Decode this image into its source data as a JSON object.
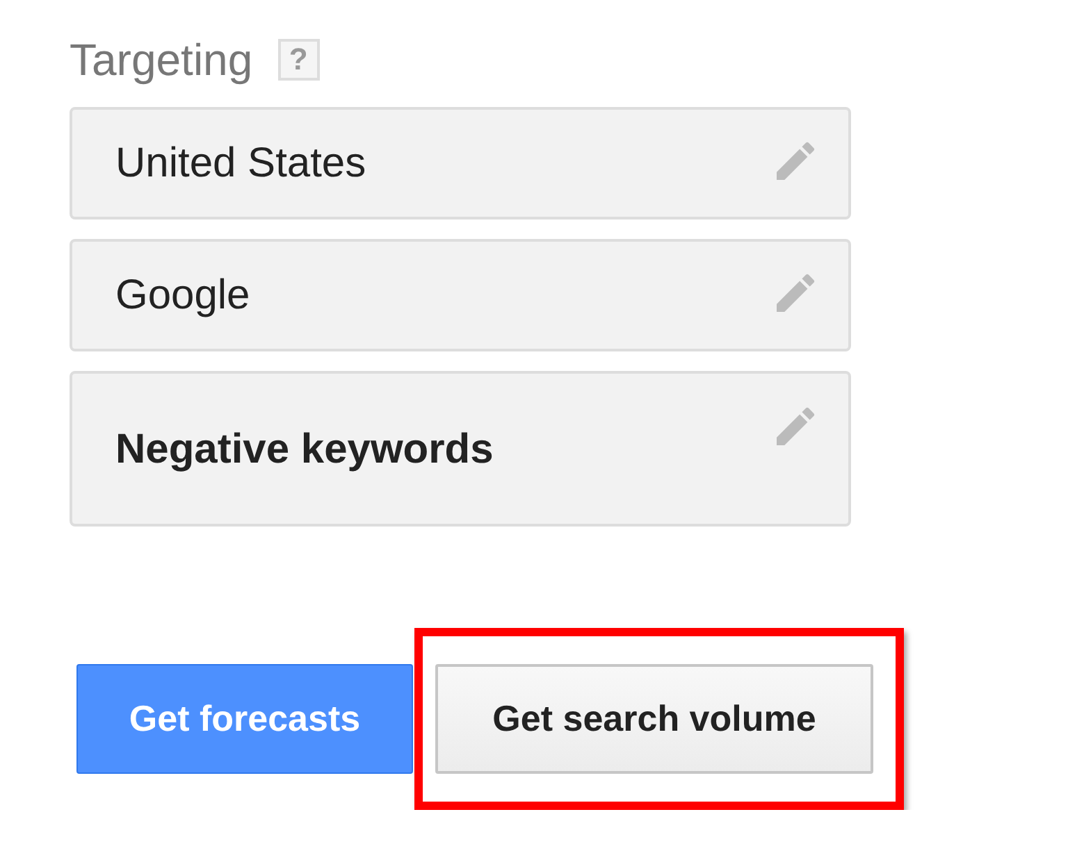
{
  "targeting": {
    "label": "Targeting",
    "help": "?"
  },
  "cards": [
    {
      "text": "United States",
      "kind": "plain"
    },
    {
      "text": "Google",
      "kind": "plain"
    },
    {
      "text": "Negative keywords",
      "kind": "bold"
    }
  ],
  "buttons": [
    {
      "label": "Get forecasts",
      "kind": "primary",
      "highlighted": false
    },
    {
      "label": "Get search volume",
      "kind": "secondary",
      "highlighted": true
    }
  ]
}
